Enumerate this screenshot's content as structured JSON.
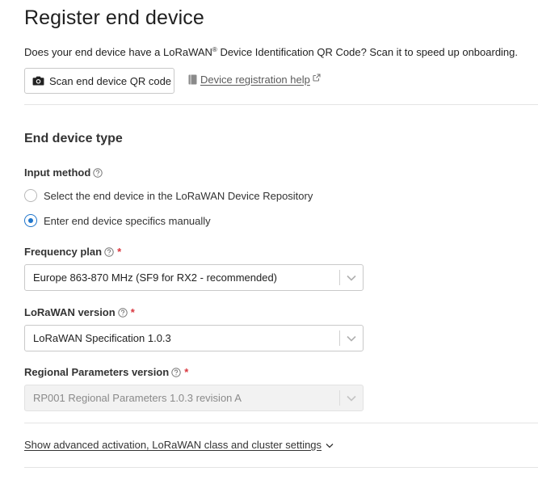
{
  "page": {
    "title": "Register end device",
    "intro_prefix": "Does your end device have a LoRaWAN",
    "intro_reg": "®",
    "intro_suffix": " Device Identification QR Code? Scan it to speed up onboarding.",
    "scan_button_label": "Scan end device QR code",
    "help_link_label": "Device registration help"
  },
  "end_device_type": {
    "section_title": "End device type",
    "input_method": {
      "label": "Input method",
      "options": [
        {
          "label": "Select the end device in the LoRaWAN Device Repository",
          "selected": false
        },
        {
          "label": "Enter end device specifics manually",
          "selected": true
        }
      ]
    },
    "frequency_plan": {
      "label": "Frequency plan",
      "required_mark": "*",
      "value": "Europe 863-870 MHz (SF9 for RX2 - recommended)"
    },
    "lorawan_version": {
      "label": "LoRaWAN version",
      "required_mark": "*",
      "value": "LoRaWAN Specification 1.0.3"
    },
    "regional_parameters_version": {
      "label": "Regional Parameters version",
      "required_mark": "*",
      "value": "RP001 Regional Parameters 1.0.3 revision A",
      "disabled": true
    },
    "advanced_link_label": "Show advanced activation, LoRaWAN class and cluster settings"
  },
  "icons": {
    "scan_button": "camera-icon",
    "help_link": "book-icon",
    "external": "external-link-icon",
    "field_help": "help-circle-icon",
    "select": "chevron-down-icon"
  },
  "colors": {
    "accent": "#1f75cb",
    "required": "#d9363e",
    "text": "#222222",
    "muted": "#5a5a5a"
  }
}
